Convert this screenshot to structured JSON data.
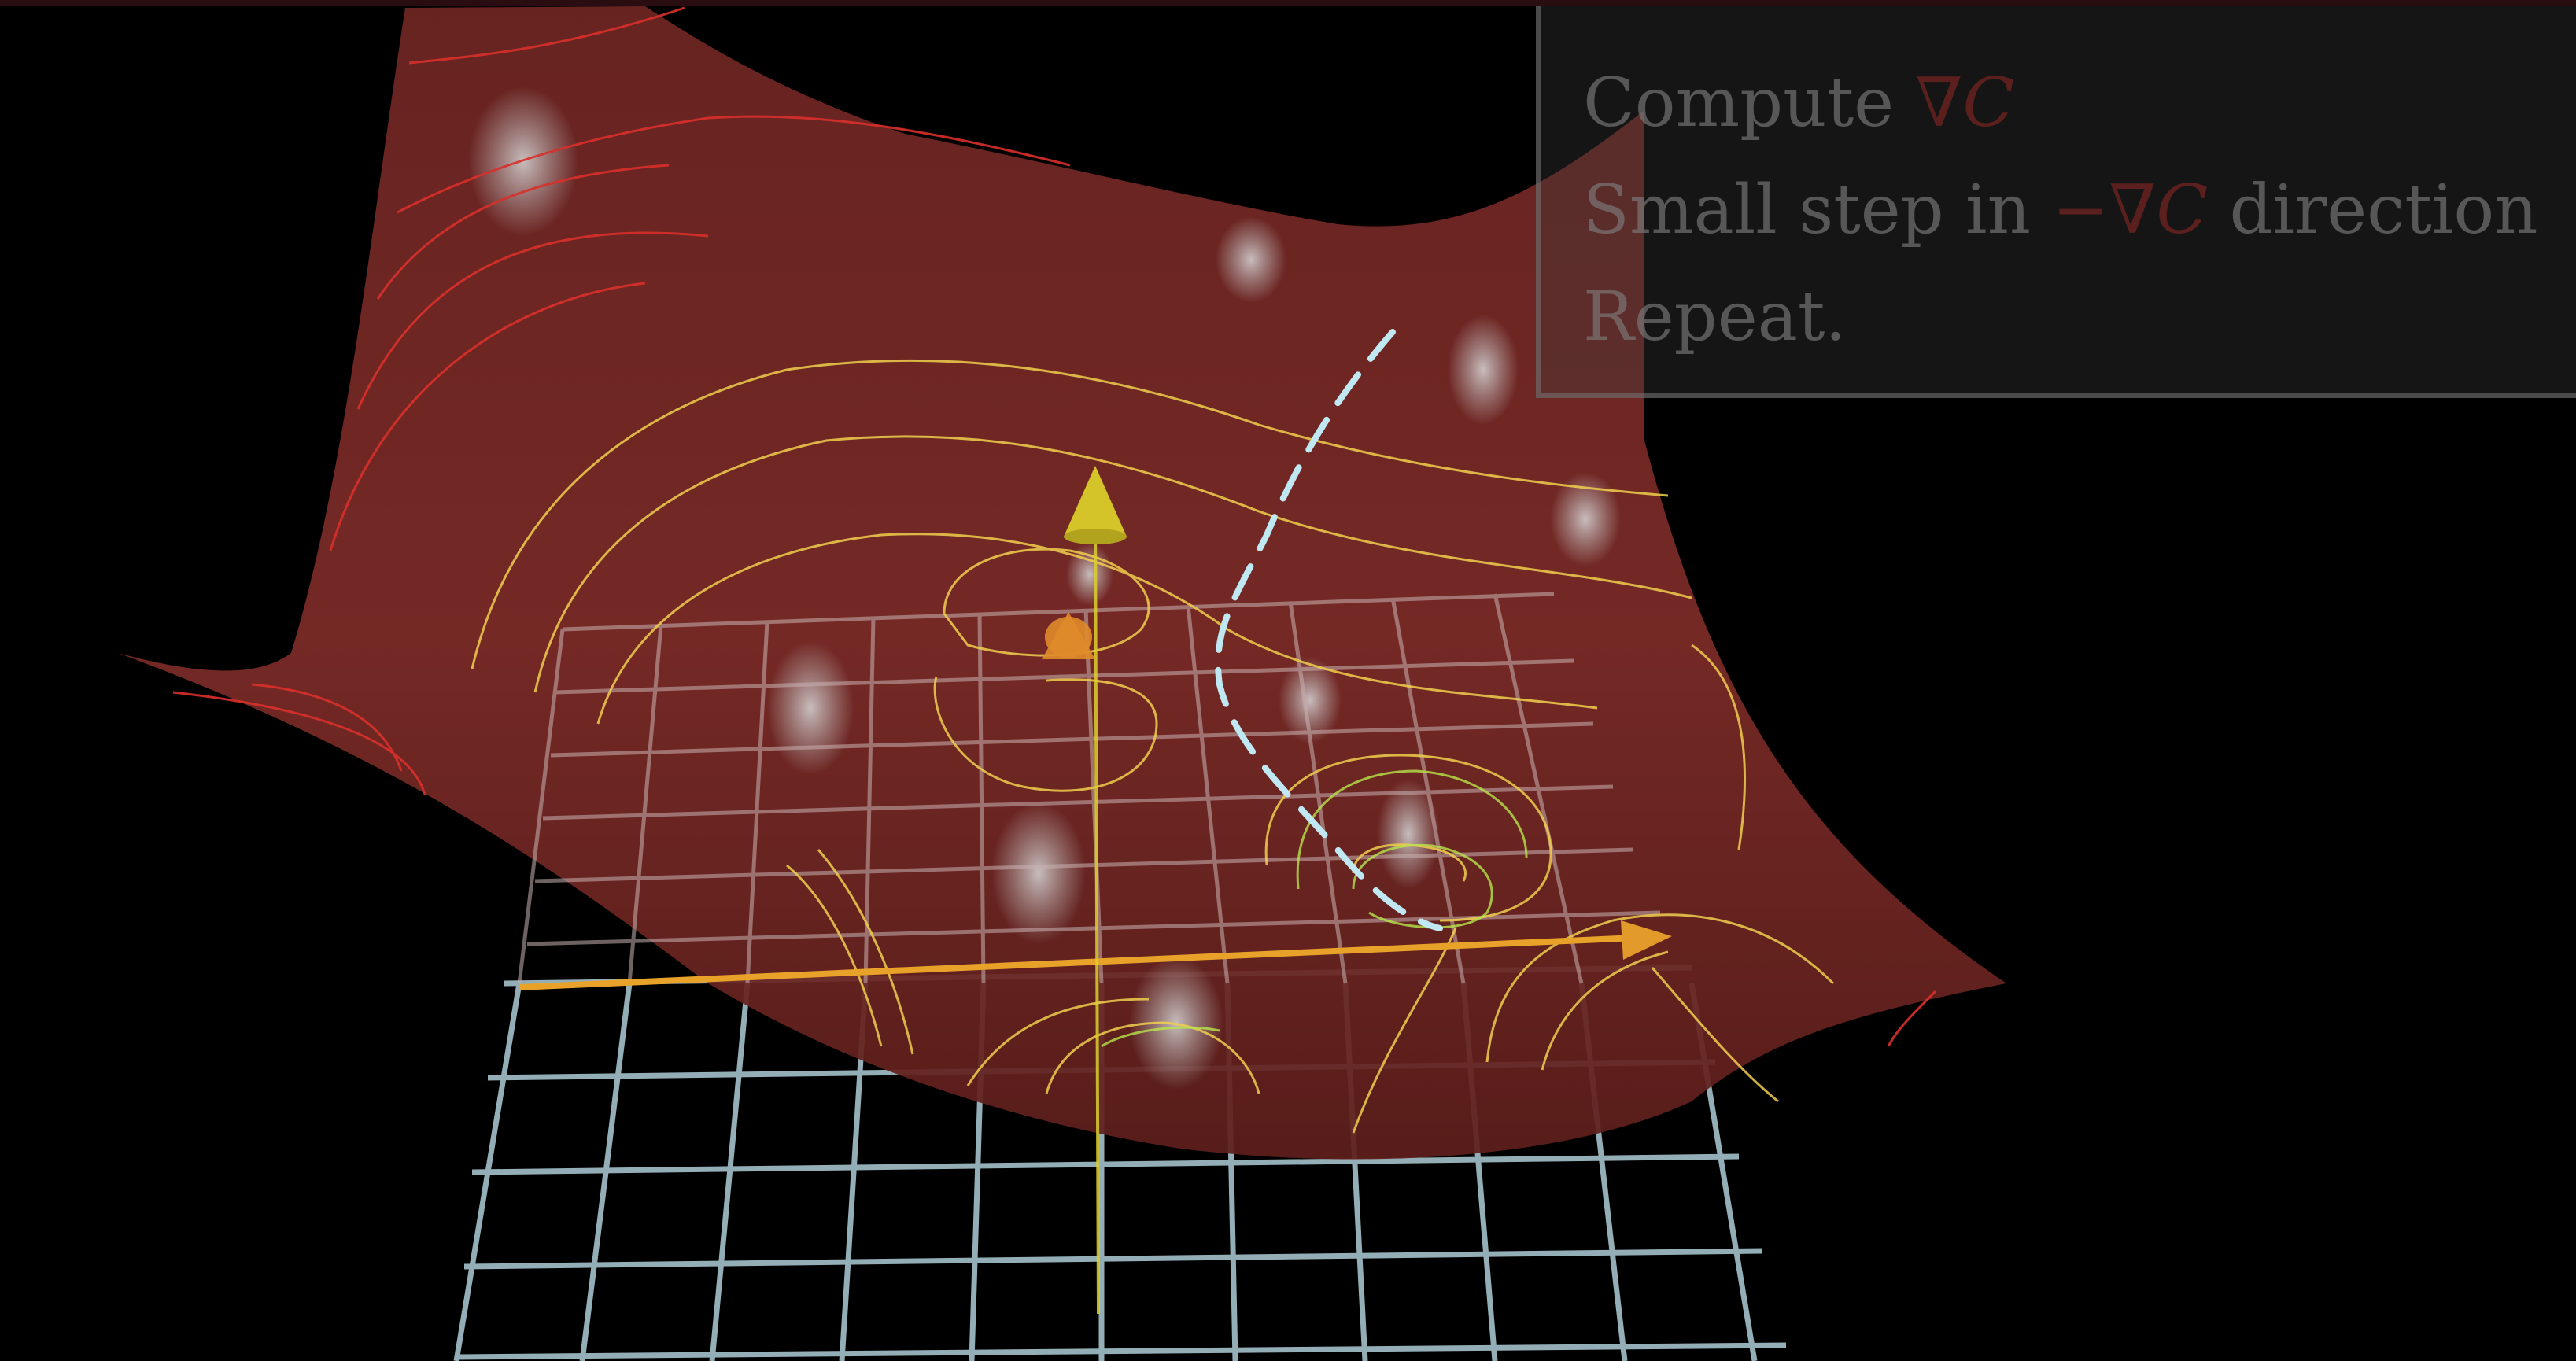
{
  "steps": [
    {
      "before": "Compute ",
      "math": "∇C",
      "after": ""
    },
    {
      "before": "Small step in ",
      "math": "−∇C",
      "after": " direction"
    },
    {
      "before": "Repeat.",
      "math": "",
      "after": ""
    }
  ],
  "colors": {
    "background": "#000000",
    "surface": "#7a2a26",
    "grid": "#a3c0c8",
    "contour_yellow": "#f2e35a",
    "contour_red": "#e0302a",
    "path": "#bfe8f2",
    "axis_orange": "#e8a22a",
    "axis_yellow": "#dccf2e",
    "text": "#808080"
  }
}
